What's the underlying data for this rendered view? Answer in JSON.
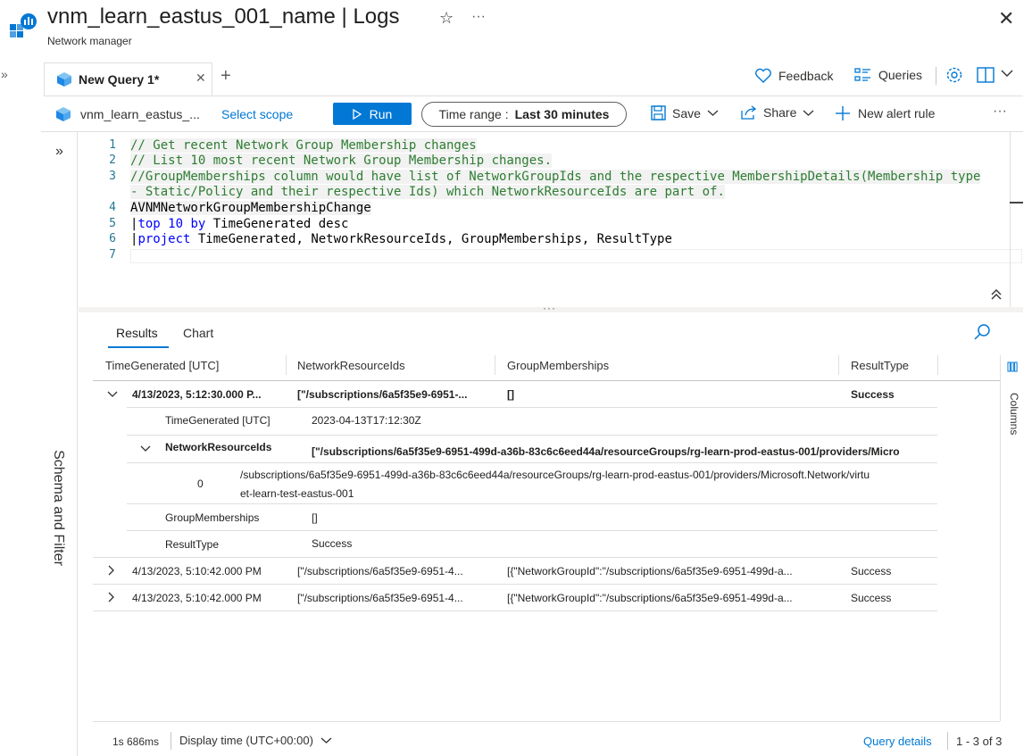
{
  "header": {
    "title": "vnm_learn_eastus_001_name | Logs",
    "subtitle": "Network manager"
  },
  "tabs": [
    {
      "label": "New Query 1*"
    }
  ],
  "top_actions": {
    "feedback": "Feedback",
    "queries": "Queries"
  },
  "toolbar": {
    "scope_name": "vnm_learn_eastus_...",
    "select_scope": "Select scope",
    "run": "Run",
    "time_range_label": "Time range :",
    "time_range_value": "Last 30 minutes",
    "save": "Save",
    "share": "Share",
    "new_alert_rule": "New alert rule"
  },
  "side_panel": {
    "label": "Schema and Filter"
  },
  "editor": {
    "lines": [
      {
        "n": "1",
        "text": "// Get recent Network Group Membership changes"
      },
      {
        "n": "2",
        "text": "// List 10 most recent Network Group Membership changes."
      },
      {
        "n": "3",
        "text": "//GroupMemberships column would have list of NetworkGroupIds and the respective MembershipDetails(Membership type"
      },
      {
        "n": "",
        "text": "- Static/Policy and their respective Ids) which NetworkResourceIds are part of."
      },
      {
        "n": "4",
        "text": "AVNMNetworkGroupMembershipChange"
      },
      {
        "n": "5",
        "kw": "top 10 by",
        "text": " TimeGenerated desc"
      },
      {
        "n": "6",
        "kw": "project",
        "text": " TimeGenerated, NetworkResourceIds, GroupMemberships, ResultType"
      },
      {
        "n": "7",
        "text": ""
      }
    ]
  },
  "results": {
    "tabs": [
      "Results",
      "Chart"
    ],
    "columns": [
      "TimeGenerated [UTC]",
      "NetworkResourceIds",
      "GroupMemberships",
      "ResultType"
    ],
    "row1": {
      "time": "4/13/2023, 5:12:30.000 P...",
      "ids": "[\"/subscriptions/6a5f35e9-6951-...",
      "groups": "[]",
      "result": "Success"
    },
    "detail": {
      "time_label": "TimeGenerated [UTC]",
      "time_value": "2023-04-13T17:12:30Z",
      "ids_label": "NetworkResourceIds",
      "ids_value": "[\"/subscriptions/6a5f35e9-6951-499d-a36b-83c6c6eed44a/resourceGroups/rg-learn-prod-eastus-001/providers/Micro",
      "index": "0",
      "path_line1": "/subscriptions/6a5f35e9-6951-499d-a36b-83c6c6eed44a/resourceGroups/rg-learn-prod-eastus-001/providers/Microsoft.Network/virtu",
      "path_line2": "et-learn-test-eastus-001",
      "groups_label": "GroupMemberships",
      "groups_value": "[]",
      "result_label": "ResultType",
      "result_value": "Success"
    },
    "rows": [
      {
        "time": "4/13/2023, 5:10:42.000 PM",
        "ids": "[\"/subscriptions/6a5f35e9-6951-4...",
        "groups": "[{\"NetworkGroupId\":\"/subscriptions/6a5f35e9-6951-499d-a...",
        "result": "Success"
      },
      {
        "time": "4/13/2023, 5:10:42.000 PM",
        "ids": "[\"/subscriptions/6a5f35e9-6951-4...",
        "groups": "[{\"NetworkGroupId\":\"/subscriptions/6a5f35e9-6951-499d-a...",
        "result": "Success"
      }
    ],
    "columns_panel": "Columns"
  },
  "footer": {
    "duration": "1s 686ms",
    "display_time": "Display time (UTC+00:00)",
    "query_details": "Query details",
    "count": "1 - 3 of 3"
  },
  "colors": {
    "accent": "#0078d4",
    "comment": "#2e7d32",
    "keyword": "#0000ff"
  }
}
